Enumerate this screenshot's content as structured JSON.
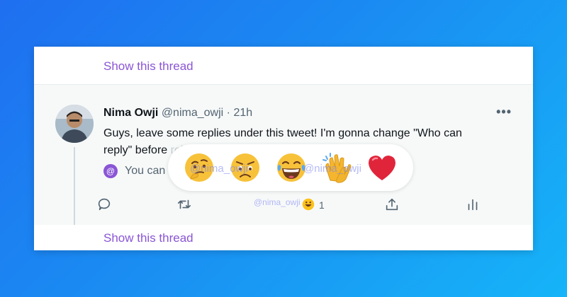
{
  "thread_link_top": "Show this thread",
  "thread_link_bottom": "Show this thread",
  "tweet": {
    "name": "Nima Owji",
    "handle": "@nima_owji",
    "separator": "·",
    "time": "21h",
    "more_icon": "more-horizontal-icon",
    "text_line1": "Guys, leave some replies under this tweet! I'm gonna change \"Who can",
    "text_line2": "reply\" before",
    "text_obscured": " releasing"
  },
  "who_can_reply": {
    "at_symbol": "@",
    "text": "You can reply"
  },
  "actions": {
    "like_count": "1",
    "icons": [
      "reply-icon",
      "retweet-icon",
      "react-icon",
      "share-icon",
      "analytics-icon"
    ]
  },
  "watermark": "@nima_owji",
  "reactions": {
    "items": [
      "thinking",
      "sad",
      "laughing",
      "clapping",
      "heart"
    ]
  },
  "colors": {
    "accent": "#8a55d6",
    "background_start": "#1f6ff0",
    "background_end": "#16b4f8"
  }
}
